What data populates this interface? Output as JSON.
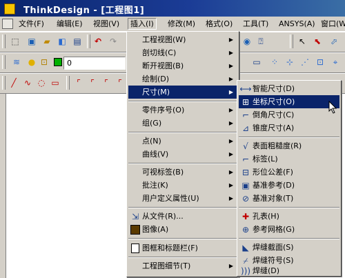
{
  "window": {
    "title": "ThinkDesign  - [工程图1]"
  },
  "menubar": {
    "items": [
      "文件(F)",
      "编辑(E)",
      "视图(V)",
      "插入(I)",
      "修改(M)",
      "格式(O)",
      "工具(T)",
      "ANSYS(A)",
      "窗口(W)"
    ]
  },
  "toolbar": {
    "layer_value": "0"
  },
  "insert_menu": {
    "items": [
      {
        "label": "工程视图(W)",
        "has_sub": true
      },
      {
        "label": "剖切线(C)",
        "has_sub": true
      },
      {
        "label": "断开视图(B)",
        "has_sub": true
      },
      {
        "label": "绘制(D)",
        "has_sub": true
      },
      {
        "label": "尺寸(M)",
        "has_sub": true,
        "highlighted": true
      },
      {
        "label": "零件序号(O)",
        "has_sub": true
      },
      {
        "label": "组(G)",
        "has_sub": true
      },
      {
        "label": "点(N)",
        "has_sub": true
      },
      {
        "label": "曲线(V)",
        "has_sub": true
      },
      {
        "label": "可视标签(B)",
        "has_sub": true
      },
      {
        "label": "批注(K)",
        "has_sub": true
      },
      {
        "label": "用户定义属性(U)",
        "has_sub": true
      },
      {
        "label": "从文件(R)...",
        "icon": "from-file-icon"
      },
      {
        "label": "图像(A)",
        "icon": "image-icon"
      },
      {
        "label": "图框和标题栏(F)",
        "icon": "frame-icon"
      },
      {
        "label": "工程图细节(T)",
        "has_sub": true
      }
    ]
  },
  "dimension_menu": {
    "items": [
      {
        "label": "智能尺寸(D)",
        "icon": "smart-dimension-icon"
      },
      {
        "label": "坐标尺寸(O)",
        "icon": "coordinate-dimension-icon",
        "highlighted": true
      },
      {
        "label": "倒角尺寸(C)",
        "icon": "chamfer-dimension-icon"
      },
      {
        "label": "锥度尺寸(A)",
        "icon": "taper-dimension-icon"
      },
      {
        "label": "表面粗糙度(R)",
        "icon": "surface-roughness-icon"
      },
      {
        "label": "标签(L)",
        "icon": "label-icon"
      },
      {
        "label": "形位公差(F)",
        "icon": "geometric-tolerance-icon"
      },
      {
        "label": "基准参考(D)",
        "icon": "datum-reference-icon"
      },
      {
        "label": "基准对象(T)",
        "icon": "datum-object-icon"
      },
      {
        "label": "孔表(H)",
        "icon": "hole-table-icon"
      },
      {
        "label": "参考网格(G)",
        "icon": "reference-grid-icon"
      },
      {
        "label": "焊缝截面(S)",
        "icon": "weld-section-icon"
      },
      {
        "label": "焊缝符号(S)",
        "icon": "weld-symbol-icon"
      },
      {
        "label": "焊缝(D)",
        "icon": "weld-icon"
      }
    ]
  },
  "colors": {
    "highlight": "#0a246a",
    "title_bar": "#0a246a",
    "chrome": "#d4d0c8"
  }
}
